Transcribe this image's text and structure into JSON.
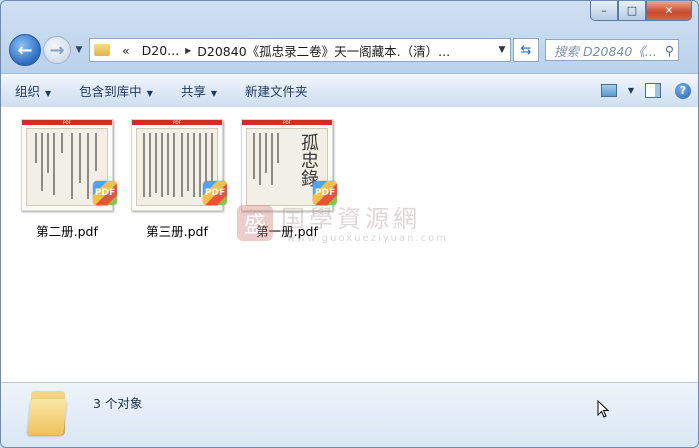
{
  "window": {
    "buttons": {
      "minimize": "–",
      "maximize": "□",
      "close": "✕"
    }
  },
  "address": {
    "overflow": "«",
    "crumbs": [
      "D20...",
      "D20840《孤忠录二卷》天一阁藏本.（清）..."
    ],
    "search_placeholder": "搜索 D20840《..."
  },
  "toolbar": {
    "organize": "组织",
    "include_library": "包含到库中",
    "share": "共享",
    "new_folder": "新建文件夹"
  },
  "files": [
    {
      "name": "第二册.pdf",
      "badge": "PDF",
      "banner": "PDF"
    },
    {
      "name": "第三册.pdf",
      "badge": "PDF",
      "banner": "PDF"
    },
    {
      "name": "第一册.pdf",
      "badge": "PDF",
      "banner": "PDF",
      "cover_text": "孤忠錄"
    }
  ],
  "watermark": {
    "mark": "盛",
    "title": "国學資源網",
    "url": "www.guoxueziyuan.com"
  },
  "status": {
    "count_text": "3 个对象"
  },
  "colors": {
    "accent": "#2a6bc2",
    "close": "#c8492b",
    "pdf_banner": "#d52a2a"
  }
}
